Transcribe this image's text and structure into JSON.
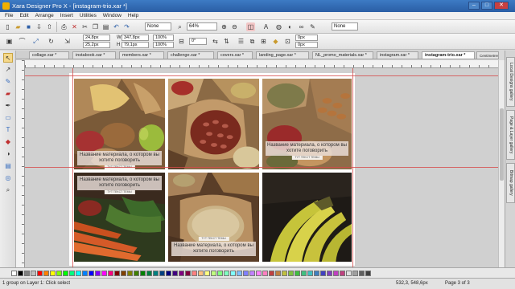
{
  "window": {
    "title": "Xara Designer Pro X - [instagram-trio.xar *]",
    "minimize": "–",
    "maximize": "□",
    "close": "✕"
  },
  "menu": [
    "File",
    "Edit",
    "Arrange",
    "Insert",
    "Utilities",
    "Window",
    "Help"
  ],
  "toolbar1": {
    "quality": "None",
    "zoom": "64%",
    "style": "None"
  },
  "toolbar2": {
    "x": "24,8px",
    "y": "25,2px",
    "w_label": "W",
    "w": "347,8px",
    "h_label": "H",
    "h": "79,1px",
    "pct1": "100%",
    "pct2": "100%",
    "rot": "0°",
    "f1": "0px",
    "f2": "0px"
  },
  "tabs": [
    {
      "label": "collage.xar *",
      "active": false
    },
    {
      "label": "instabook.xar *",
      "active": false
    },
    {
      "label": "members.xar *",
      "active": false
    },
    {
      "label": "challenge.xar *",
      "active": false
    },
    {
      "label": "covers.xar *",
      "active": false
    },
    {
      "label": "landing_page.xar *",
      "active": false
    },
    {
      "label": "NL_promo_materials.xar *",
      "active": false
    },
    {
      "label": "instagram.xar *",
      "active": false
    },
    {
      "label": "instagram-trio.xar *",
      "active": true
    }
  ],
  "units_label": "Centimetres",
  "tiles": {
    "t1": {
      "caption": "Название материала, о котором вы хотите поговорить",
      "tag": "TYT TEKCT TEMЫ"
    },
    "t3": {
      "caption": "Название материала, о котором вы хотите поговорить",
      "tag": "TYT TEKCT TEMЫ"
    },
    "t4": {
      "caption": "Название материала, о котором вы хотите поговорить",
      "tag": "TYT TEKCT TEMЫ"
    },
    "t5": {
      "caption": "Название материала, о котором вы хотите поговорить",
      "tag": "TYT TEKCT TEMЫ"
    }
  },
  "galleries": [
    "Local Designs gallery",
    "Page & Layer gallery",
    "Bitmap gallery"
  ],
  "palette_colors": [
    "#ffffff",
    "#000000",
    "#808080",
    "#c0c0c0",
    "#ff0000",
    "#ff8000",
    "#ffff00",
    "#80ff00",
    "#00ff00",
    "#00ff80",
    "#00ffff",
    "#0080ff",
    "#0000ff",
    "#8000ff",
    "#ff00ff",
    "#ff0080",
    "#800000",
    "#804000",
    "#808000",
    "#408000",
    "#008000",
    "#008040",
    "#008080",
    "#004080",
    "#000080",
    "#400080",
    "#800080",
    "#800040",
    "#ff8080",
    "#ffc080",
    "#ffff80",
    "#c0ff80",
    "#80ff80",
    "#80ffc0",
    "#80ffff",
    "#80c0ff",
    "#8080ff",
    "#c080ff",
    "#ff80ff",
    "#ff80c0",
    "#c04040",
    "#c08040",
    "#c0c040",
    "#80c040",
    "#40c040",
    "#40c080",
    "#40c0c0",
    "#4080c0",
    "#4040c0",
    "#8040c0",
    "#c040c0",
    "#c04080",
    "#e0e0e0",
    "#a0a0a0",
    "#606060",
    "#404040"
  ],
  "status": {
    "message": "1 group on Layer 1: Click select",
    "coords": "532,3, 548,6px",
    "page": "Page 3 of 3"
  }
}
